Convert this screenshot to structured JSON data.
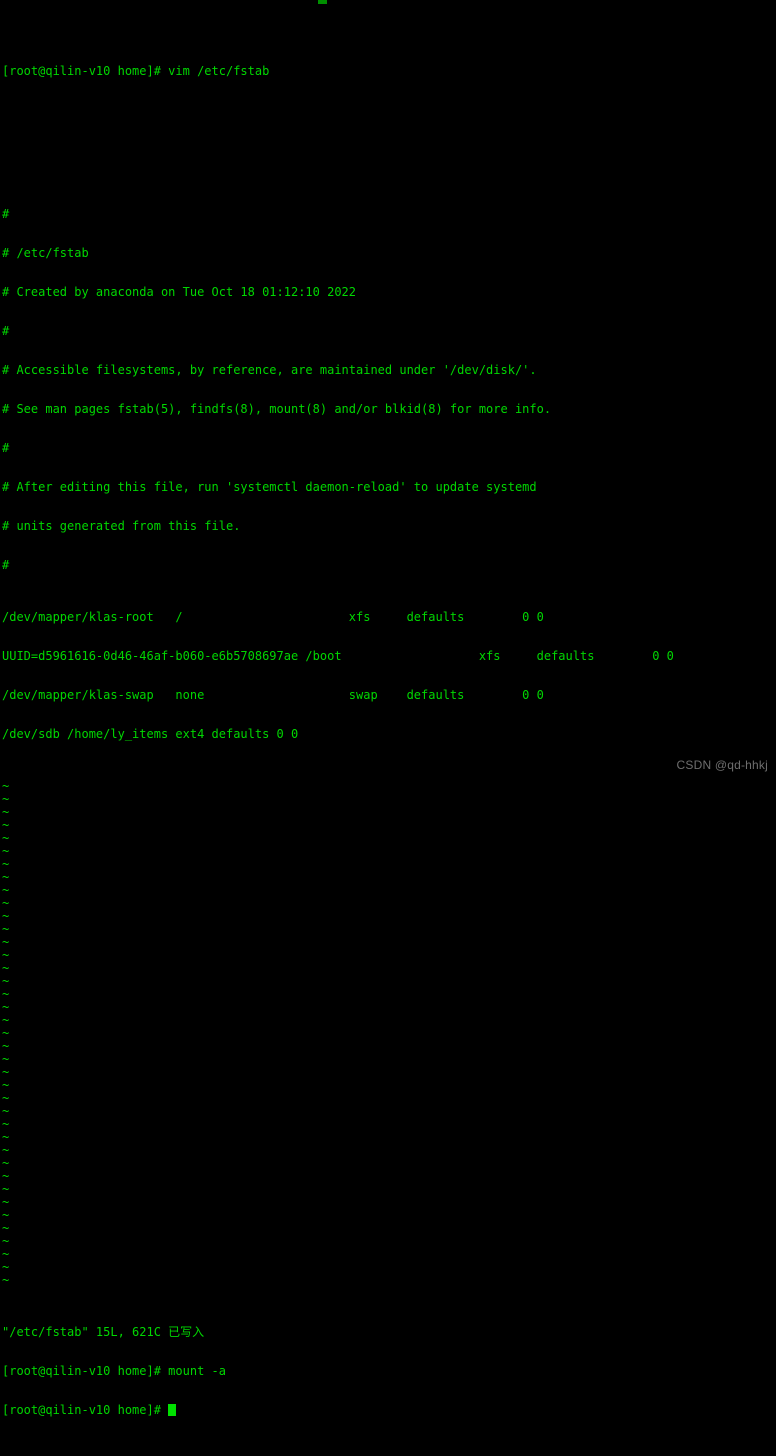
{
  "terminal": {
    "prompt": "[root@qilin-v10 home]#",
    "foreground_color": "#00d700",
    "background_color": "#000000",
    "cursor_color": "#00e000",
    "command_line": "[root@qilin-v10 home]# vim /etc/fstab",
    "blank": ""
  },
  "file": {
    "name": "/etc/fstab",
    "comments": [
      "#",
      "# /etc/fstab",
      "# Created by anaconda on Tue Oct 18 01:12:10 2022",
      "#",
      "# Accessible filesystems, by reference, are maintained under '/dev/disk/'.",
      "# See man pages fstab(5), findfs(8), mount(8) and/or blkid(8) for more info.",
      "#",
      "# After editing this file, run 'systemctl daemon-reload' to update systemd",
      "# units generated from this file.",
      "#"
    ],
    "entries": [
      "/dev/mapper/klas-root   /                       xfs     defaults        0 0",
      "UUID=d5961616-0d46-46af-b060-e6b5708697ae /boot                   xfs     defaults        0 0",
      "/dev/mapper/klas-swap   none                    swap    defaults        0 0",
      "/dev/sdb /home/ly_items ext4 defaults 0 0"
    ],
    "empty_marker": "~",
    "empty_marker_count": 39
  },
  "status": {
    "write_message": "\"/etc/fstab\" 15L, 621C 已写入",
    "mount_command": "[root@qilin-v10 home]# mount -a",
    "final_prompt": "[root@qilin-v10 home]# "
  },
  "watermark": {
    "text": "CSDN @qd-hhkj",
    "color": "#6e6e6e"
  }
}
